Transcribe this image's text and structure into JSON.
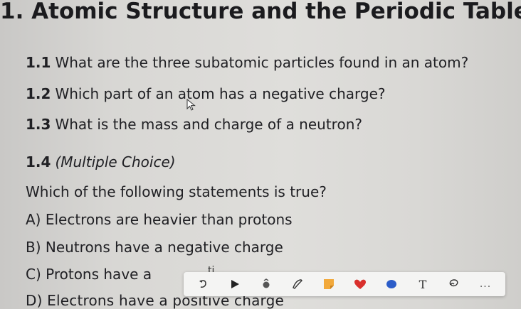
{
  "document": {
    "title": "1. Atomic Structure and the Periodic Table",
    "questions": [
      {
        "number": "1.1",
        "text": "What are the three subatomic particles found in an atom?"
      },
      {
        "number": "1.2",
        "text": "Which part of an atom has a negative charge?"
      },
      {
        "number": "1.3",
        "text": "What is the mass and charge of a neutron?"
      }
    ],
    "mc": {
      "number": "1.4",
      "label": "(Multiple Choice)",
      "stem": "Which of the following statements is true?",
      "options": [
        "A) Electrons are heavier than protons",
        "B) Neutrons have a negative charge",
        "C) Protons have a",
        "D) Electrons have a positive charge"
      ]
    }
  },
  "toolbar": {
    "partial_text": "ti",
    "tools": [
      "undo-icon",
      "play-icon",
      "eraser-icon",
      "pen-icon",
      "sticky-note-icon",
      "heart-icon",
      "blob-icon",
      "text-tool-icon",
      "lasso-icon",
      "more-icon"
    ],
    "text_label": "T",
    "more_label": "...",
    "colors": {
      "sticky": "#f2a93b",
      "heart": "#d9302c",
      "blob": "#2b5cc8"
    }
  }
}
